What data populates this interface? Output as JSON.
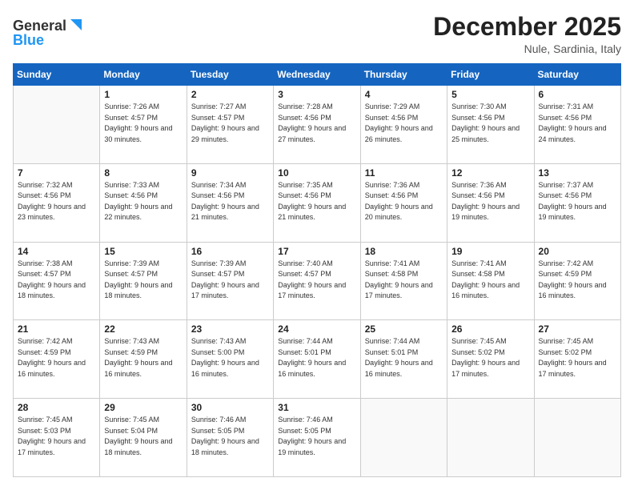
{
  "header": {
    "logo_general": "General",
    "logo_blue": "Blue",
    "month_title": "December 2025",
    "location": "Nule, Sardinia, Italy"
  },
  "calendar": {
    "days_of_week": [
      "Sunday",
      "Monday",
      "Tuesday",
      "Wednesday",
      "Thursday",
      "Friday",
      "Saturday"
    ],
    "weeks": [
      [
        {
          "day": "",
          "sunrise": "",
          "sunset": "",
          "daylight": ""
        },
        {
          "day": "1",
          "sunrise": "Sunrise: 7:26 AM",
          "sunset": "Sunset: 4:57 PM",
          "daylight": "Daylight: 9 hours and 30 minutes."
        },
        {
          "day": "2",
          "sunrise": "Sunrise: 7:27 AM",
          "sunset": "Sunset: 4:57 PM",
          "daylight": "Daylight: 9 hours and 29 minutes."
        },
        {
          "day": "3",
          "sunrise": "Sunrise: 7:28 AM",
          "sunset": "Sunset: 4:56 PM",
          "daylight": "Daylight: 9 hours and 27 minutes."
        },
        {
          "day": "4",
          "sunrise": "Sunrise: 7:29 AM",
          "sunset": "Sunset: 4:56 PM",
          "daylight": "Daylight: 9 hours and 26 minutes."
        },
        {
          "day": "5",
          "sunrise": "Sunrise: 7:30 AM",
          "sunset": "Sunset: 4:56 PM",
          "daylight": "Daylight: 9 hours and 25 minutes."
        },
        {
          "day": "6",
          "sunrise": "Sunrise: 7:31 AM",
          "sunset": "Sunset: 4:56 PM",
          "daylight": "Daylight: 9 hours and 24 minutes."
        }
      ],
      [
        {
          "day": "7",
          "sunrise": "Sunrise: 7:32 AM",
          "sunset": "Sunset: 4:56 PM",
          "daylight": "Daylight: 9 hours and 23 minutes."
        },
        {
          "day": "8",
          "sunrise": "Sunrise: 7:33 AM",
          "sunset": "Sunset: 4:56 PM",
          "daylight": "Daylight: 9 hours and 22 minutes."
        },
        {
          "day": "9",
          "sunrise": "Sunrise: 7:34 AM",
          "sunset": "Sunset: 4:56 PM",
          "daylight": "Daylight: 9 hours and 21 minutes."
        },
        {
          "day": "10",
          "sunrise": "Sunrise: 7:35 AM",
          "sunset": "Sunset: 4:56 PM",
          "daylight": "Daylight: 9 hours and 21 minutes."
        },
        {
          "day": "11",
          "sunrise": "Sunrise: 7:36 AM",
          "sunset": "Sunset: 4:56 PM",
          "daylight": "Daylight: 9 hours and 20 minutes."
        },
        {
          "day": "12",
          "sunrise": "Sunrise: 7:36 AM",
          "sunset": "Sunset: 4:56 PM",
          "daylight": "Daylight: 9 hours and 19 minutes."
        },
        {
          "day": "13",
          "sunrise": "Sunrise: 7:37 AM",
          "sunset": "Sunset: 4:56 PM",
          "daylight": "Daylight: 9 hours and 19 minutes."
        }
      ],
      [
        {
          "day": "14",
          "sunrise": "Sunrise: 7:38 AM",
          "sunset": "Sunset: 4:57 PM",
          "daylight": "Daylight: 9 hours and 18 minutes."
        },
        {
          "day": "15",
          "sunrise": "Sunrise: 7:39 AM",
          "sunset": "Sunset: 4:57 PM",
          "daylight": "Daylight: 9 hours and 18 minutes."
        },
        {
          "day": "16",
          "sunrise": "Sunrise: 7:39 AM",
          "sunset": "Sunset: 4:57 PM",
          "daylight": "Daylight: 9 hours and 17 minutes."
        },
        {
          "day": "17",
          "sunrise": "Sunrise: 7:40 AM",
          "sunset": "Sunset: 4:57 PM",
          "daylight": "Daylight: 9 hours and 17 minutes."
        },
        {
          "day": "18",
          "sunrise": "Sunrise: 7:41 AM",
          "sunset": "Sunset: 4:58 PM",
          "daylight": "Daylight: 9 hours and 17 minutes."
        },
        {
          "day": "19",
          "sunrise": "Sunrise: 7:41 AM",
          "sunset": "Sunset: 4:58 PM",
          "daylight": "Daylight: 9 hours and 16 minutes."
        },
        {
          "day": "20",
          "sunrise": "Sunrise: 7:42 AM",
          "sunset": "Sunset: 4:59 PM",
          "daylight": "Daylight: 9 hours and 16 minutes."
        }
      ],
      [
        {
          "day": "21",
          "sunrise": "Sunrise: 7:42 AM",
          "sunset": "Sunset: 4:59 PM",
          "daylight": "Daylight: 9 hours and 16 minutes."
        },
        {
          "day": "22",
          "sunrise": "Sunrise: 7:43 AM",
          "sunset": "Sunset: 4:59 PM",
          "daylight": "Daylight: 9 hours and 16 minutes."
        },
        {
          "day": "23",
          "sunrise": "Sunrise: 7:43 AM",
          "sunset": "Sunset: 5:00 PM",
          "daylight": "Daylight: 9 hours and 16 minutes."
        },
        {
          "day": "24",
          "sunrise": "Sunrise: 7:44 AM",
          "sunset": "Sunset: 5:01 PM",
          "daylight": "Daylight: 9 hours and 16 minutes."
        },
        {
          "day": "25",
          "sunrise": "Sunrise: 7:44 AM",
          "sunset": "Sunset: 5:01 PM",
          "daylight": "Daylight: 9 hours and 16 minutes."
        },
        {
          "day": "26",
          "sunrise": "Sunrise: 7:45 AM",
          "sunset": "Sunset: 5:02 PM",
          "daylight": "Daylight: 9 hours and 17 minutes."
        },
        {
          "day": "27",
          "sunrise": "Sunrise: 7:45 AM",
          "sunset": "Sunset: 5:02 PM",
          "daylight": "Daylight: 9 hours and 17 minutes."
        }
      ],
      [
        {
          "day": "28",
          "sunrise": "Sunrise: 7:45 AM",
          "sunset": "Sunset: 5:03 PM",
          "daylight": "Daylight: 9 hours and 17 minutes."
        },
        {
          "day": "29",
          "sunrise": "Sunrise: 7:45 AM",
          "sunset": "Sunset: 5:04 PM",
          "daylight": "Daylight: 9 hours and 18 minutes."
        },
        {
          "day": "30",
          "sunrise": "Sunrise: 7:46 AM",
          "sunset": "Sunset: 5:05 PM",
          "daylight": "Daylight: 9 hours and 18 minutes."
        },
        {
          "day": "31",
          "sunrise": "Sunrise: 7:46 AM",
          "sunset": "Sunset: 5:05 PM",
          "daylight": "Daylight: 9 hours and 19 minutes."
        },
        {
          "day": "",
          "sunrise": "",
          "sunset": "",
          "daylight": ""
        },
        {
          "day": "",
          "sunrise": "",
          "sunset": "",
          "daylight": ""
        },
        {
          "day": "",
          "sunrise": "",
          "sunset": "",
          "daylight": ""
        }
      ]
    ]
  }
}
